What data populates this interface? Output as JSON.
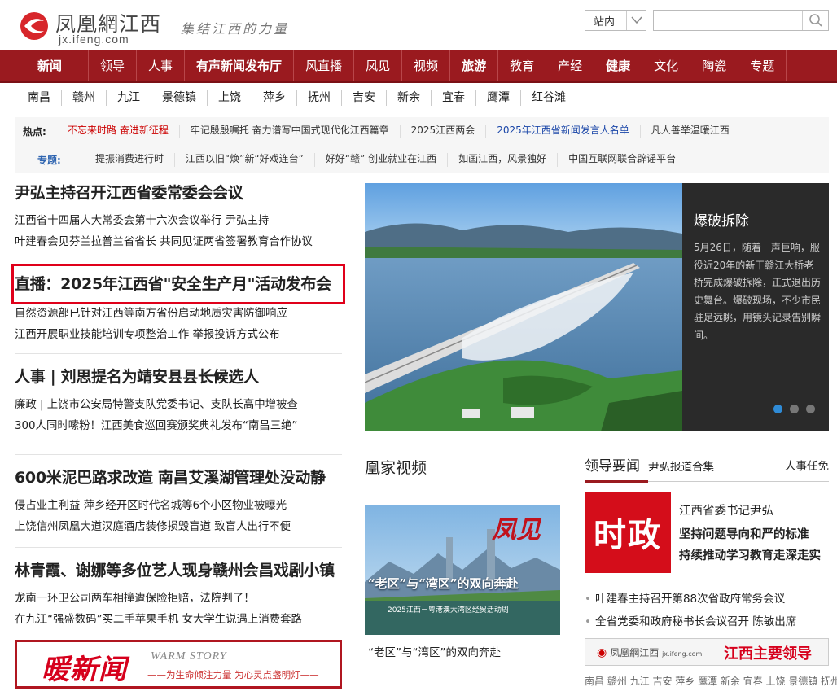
{
  "header": {
    "logo_cn": "凤凰網江西",
    "logo_domain": "jx.ifeng.com",
    "slogan": "集结江西的力量",
    "search_scope": "站内",
    "search_placeholder": ""
  },
  "nav": [
    "新闻",
    "领导",
    "人事",
    "有声新闻发布厅",
    "风直播",
    "凤见",
    "视频",
    "旅游",
    "教育",
    "产经",
    "健康",
    "文化",
    "陶瓷",
    "专题"
  ],
  "nav_bold": [
    "新闻",
    "有声新闻发布厅",
    "旅游",
    "健康"
  ],
  "cities": [
    "南昌",
    "赣州",
    "九江",
    "景德镇",
    "上饶",
    "萍乡",
    "抚州",
    "吉安",
    "新余",
    "宜春",
    "鹰潭",
    "红谷滩"
  ],
  "hot": {
    "label": "热点:",
    "items": [
      {
        "text": "不忘来时路 奋进新征程",
        "style": "red"
      },
      {
        "text": "牢记殷殷嘱托 奋力谱写中国式现代化江西篇章",
        "style": ""
      },
      {
        "text": "2025江西两会",
        "style": ""
      },
      {
        "text": "2025年江西省新闻发言人名单",
        "style": "blue"
      },
      {
        "text": "凡人善举温暖江西",
        "style": ""
      }
    ]
  },
  "special": {
    "label": "专题:",
    "items": [
      "提振消费进行时",
      "江西以旧“焕”新“好戏连台”",
      "好好“赣” 创业就业在江西",
      "如画江西，风景独好",
      "中国互联网联合辟谣平台"
    ]
  },
  "left_news": [
    {
      "headline": "尹弘主持召开江西省委常委会会议",
      "subs": [
        "江西省十四届人大常委会第十六次会议举行 尹弘主持",
        "叶建春会见芬兰拉普兰省省长 共同见证两省签署教育合作协议"
      ]
    },
    {
      "headline": "直播：2025年江西省\"安全生产月\"活动发布会",
      "subs": [
        "自然资源部已针对江西等南方省份启动地质灾害防御响应",
        "江西开展职业技能培训专项整治工作 举报投诉方式公布"
      ]
    },
    {
      "headline": "人事 | 刘思提名为靖安县县长候选人",
      "subs": [
        "廉政 | 上饶市公安局特警支队党委书记、支队长高中增被查",
        "300人同时嗦粉！江西美食巡回赛颁奖典礼发布“南昌三绝”"
      ]
    },
    {
      "headline": "600米泥巴路求改造 南昌艾溪湖管理处没动静",
      "subs": [
        "侵占业主利益 萍乡经开区时代名城等6个小区物业被曝光",
        "上饶信州凤凰大道汉庭酒店装修损毁盲道 致盲人出行不便"
      ]
    },
    {
      "headline": "林青霞、谢娜等多位艺人现身赣州会昌戏剧小镇",
      "subs": [
        "龙南一环卫公司两车相撞遭保险拒赔，法院判了！",
        "在九江“强盛数码”买二手苹果手机 女大学生说遇上消费套路"
      ]
    }
  ],
  "warm": {
    "big": "暖新闻",
    "en": "WARM STORY",
    "sub": "——为生命倾注力量 为心灵点盏明灯——"
  },
  "slider": {
    "title": "爆破拆除",
    "desc": "5月26日，随着一声巨响，服役近20年的新干赣江大桥老桥完成爆破拆除，正式退出历史舞台。爆破现场，不少市民驻足远眺，用镜头记录告别瞬间。",
    "active_dot": 0,
    "dot_count": 3
  },
  "video": {
    "section_title": "凰家视频",
    "thumb_brand": "凤见",
    "thumb_headline": "“老区”与“湾区”的双向奔赴",
    "thumb_sub": "2025江西－粤港澳大湾区经贸活动周",
    "caption": "“老区”与“湾区”的双向奔赴"
  },
  "leaders": {
    "tab1": "领导要闻",
    "tab2": "尹弘报道合集",
    "tab3": "人事任免",
    "badge": "时政",
    "line1": "江西省委书记尹弘",
    "line2": "坚持问题导向和严的标准",
    "line3": "持续推动学习教育走深走实",
    "bullets": [
      "叶建春主持召开第88次省政府常务会议",
      "全省党委和政府秘书长会议召开 陈敏出席"
    ],
    "banner_logo": "凤凰網江西",
    "banner_domain": "jx.ifeng.com",
    "banner_right": "江西主要领导",
    "cities_line": "南昌 赣州 九江 吉安 萍乡 鹰潭 新余 宜春 上饶 景德镇 抚州"
  },
  "colors": {
    "brand": "#9a1a1f",
    "accent_red": "#d6001c",
    "link_blue": "#1a46a8",
    "dot_active": "#2f8bd6"
  }
}
